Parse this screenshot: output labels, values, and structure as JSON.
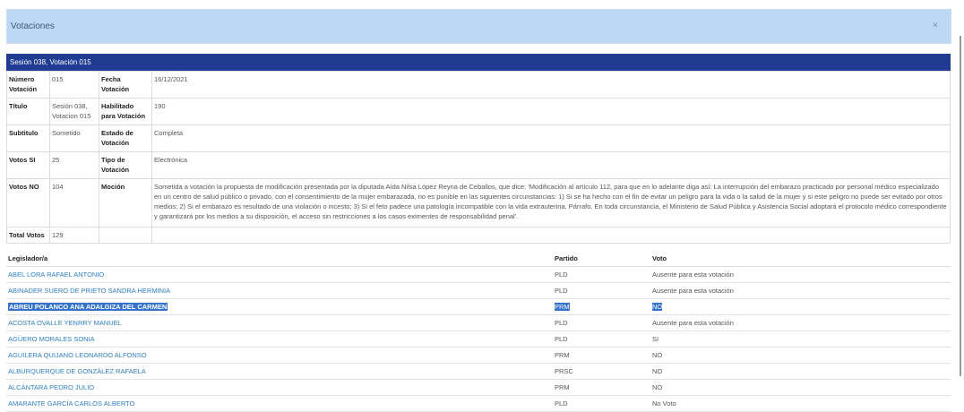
{
  "modal": {
    "title": "Votaciones",
    "close": "×"
  },
  "panel": {
    "header": "Sesión 038, Votación 015"
  },
  "info": {
    "numero_label": "Número Votación",
    "numero": "015",
    "fecha_label": "Fecha Votación",
    "fecha": "16/12/2021",
    "titulo_label": "Título",
    "titulo": "Sesión 038, Votacion 015",
    "habilitado_label": "Habilitado para Votación",
    "habilitado": "190",
    "subtitulo_label": "Subtitulo",
    "subtitulo": "Sometido",
    "estado_label": "Estado de Votación",
    "estado": "Completa",
    "si_label": "Votos SI",
    "si": "25",
    "tipo_label": "Tipo de Votación",
    "tipo": "Electrónica",
    "no_label": "Votos NO",
    "no": "104",
    "mocion_label": "Moción",
    "mocion": "Sometida a votación la propuesta de modificación presentada por la diputada Aída Nilsa López Reyna de Ceballos, que dice: 'Modificación al artículo 112, para que en lo adelante diga así: La interrupción del embarazo practicado por personal médico especializado en un centro de salud público o privado, con el consentimiento de la mujer embarazada, no es punible en las siguientes circunstancias: 1) Si se ha hecho con el fin de evitar un peligro para la vida o la salud de la mujer y si este peligro no puede ser evitado por otros medios; 2) Si el embarazo es resultado de una violación o incesto; 3) Si el feto padece una patología incompatible con la vida extrauterina. Párrafo. En toda circunstancia, el Ministerio de Salud Pública y Asistencia Social adoptará el protocolo médico correspondiente y garantizará por los medios a su disposición, el acceso sin restricciones a los casos eximentes de responsabilidad penal'.",
    "total_label": "Total Votos",
    "total": "129"
  },
  "list": {
    "headers": {
      "legislador": "Legislador/a",
      "partido": "Partido",
      "voto": "Voto"
    },
    "rows": [
      {
        "name": "ABEL LORA RAFAEL ANTONIO",
        "party": "PLD",
        "vote": "Ausente para esta votación"
      },
      {
        "name": "ABINADER SUERO DE PRIETO SANDRA HERMINIA",
        "party": "PLD",
        "vote": "Ausente para esta votación"
      },
      {
        "name": "ABREU POLANCO ANA ADALGIZA DEL CARMEN",
        "party": "PRM",
        "vote": "NO"
      },
      {
        "name": "ACOSTA OVALLE YENRRY MANUEL",
        "party": "PLD",
        "vote": "Ausente para esta votación"
      },
      {
        "name": "AGÜERO MORALES SONIA",
        "party": "PLD",
        "vote": "SI"
      },
      {
        "name": "AGUILERA QUIJANO LEONARDO ALFONSO",
        "party": "PRM",
        "vote": "NO"
      },
      {
        "name": "ALBURQUERQUE DE GONZÁLEZ RAFAELA",
        "party": "PRSC",
        "vote": "NO"
      },
      {
        "name": "ALCÁNTARA PEDRO JULIO",
        "party": "PRM",
        "vote": "NO"
      },
      {
        "name": "AMARANTE GARCÍA CARLOS ALBERTO",
        "party": "PLD",
        "vote": "No Voto"
      }
    ]
  }
}
